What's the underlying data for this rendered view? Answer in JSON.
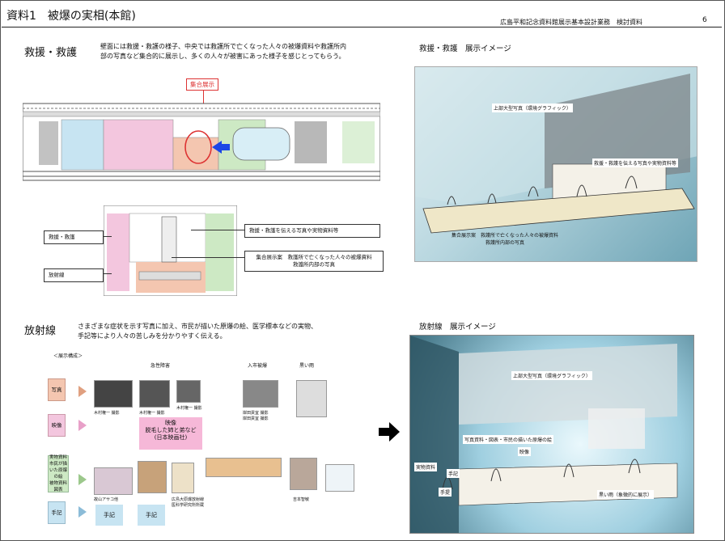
{
  "header": {
    "title": "資料1　被爆の実相(本館)",
    "subtitle": "広島平和記念資料館展示基本設計業務　検討資料",
    "page": "6"
  },
  "rescue": {
    "heading": "救援・救護",
    "description_1": "壁面には救援・救護の様子、中央では救護所で亡くなった人々の被爆資料や救護所内",
    "description_2": "部の写真など集合的に展示し、多くの人々が被害にあった様子を感じとってもらう。",
    "plan_label": "集合展示",
    "callouts": {
      "left_top": "救援・救護",
      "left_bottom": "放射線",
      "right_top": "救援・救護を伝える写真や実物資料等",
      "right_bottom_1": "集合展示案　救護所で亡くなった人々の被爆資料",
      "right_bottom_2": "救護所内部の写真"
    },
    "image_title": "救援・救護　展示イメージ",
    "image_labels": {
      "top": "上部大型写真（環境グラフィック）",
      "right": "救援・救護を伝える写真や実物資料等",
      "bottom_1": "集合展示案　救護所で亡くなった人々の被爆資料",
      "bottom_2": "救護所内部の写真"
    }
  },
  "radiation": {
    "heading": "放射線",
    "description_1": "さまざまな症状を示す写真に加え、市民が描いた原爆の絵、医学標本などの実物、",
    "description_2": "手記等により人々の苦しみを分かりやすく伝える。",
    "composition_title": "＜展示構成＞",
    "column_headers": [
      "急性障害",
      "入市被爆",
      "黒い雨"
    ],
    "categories": [
      "写真",
      "映像",
      "実物資料\n市民が描いた原爆の絵\n被物資料\n図表",
      "手記"
    ],
    "photo_captions": [
      "木村権一 撮影",
      "木村権一 撮影",
      "木村権一 撮影",
      "岸田貢宜 撮影\n岸田貢宜 撮影"
    ],
    "video_box_1": "映像",
    "video_box_2": "脱毛した姉と弟など",
    "video_box_3": "(日本映画社)",
    "item_captions": [
      "故山アサコ他",
      "",
      "広島大原爆放射線\n医科学研究所所蔵",
      "吉本智敏"
    ],
    "note_boxes": [
      "手記",
      "手記"
    ],
    "image_title": "放射線　展示イメージ",
    "image_labels": {
      "top": "上部大型写真（環境グラフィック）",
      "middle": "写真資料・図表・市民の描いた原爆の絵",
      "video": "映像",
      "objects": "実物資料",
      "note1": "手記",
      "note2": "手提",
      "black_rain": "黒い雨（象徴的に展示）"
    }
  },
  "colors": {
    "pink": "#f3c6de",
    "blue": "#c7e4f2",
    "green": "#cde9c4",
    "salmon": "#f4c6b0",
    "accent_red": "#d33"
  }
}
